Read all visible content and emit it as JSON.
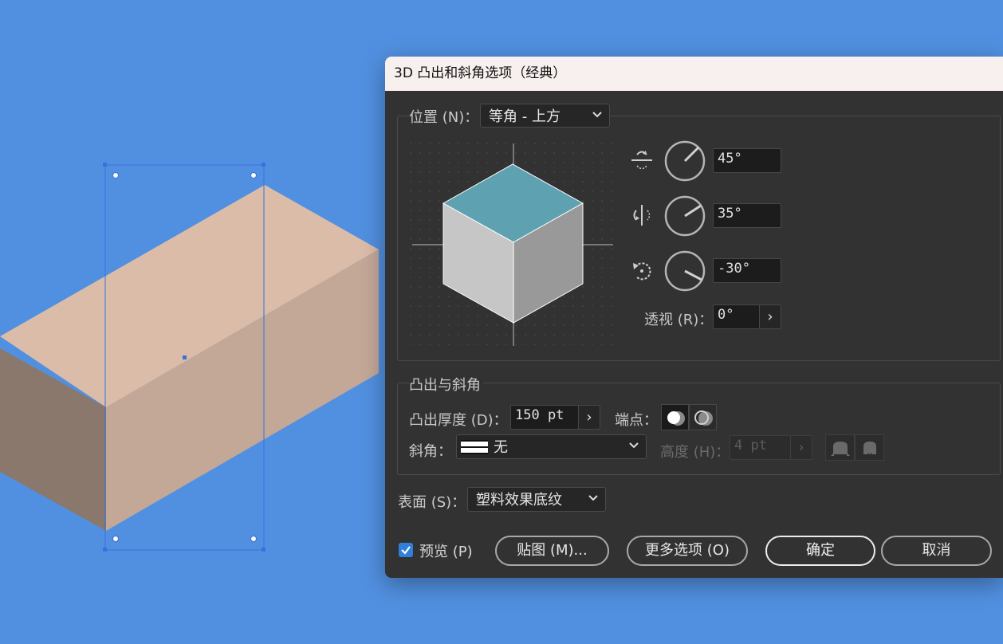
{
  "dialog": {
    "title": "3D 凸出和斜角选项（经典）",
    "position_label": "位置 (N)：",
    "position_value": "等角 - 上方",
    "rotation": {
      "x_angle": "45°",
      "y_angle": "35°",
      "z_angle": "-30°"
    },
    "perspective_label": "透视 (R)：",
    "perspective_value": "0°",
    "extrude_group_label": "凸出与斜角",
    "extrude_depth_label": "凸出厚度 (D)：",
    "extrude_depth_value": "150 pt",
    "cap_label": "端点：",
    "bevel_label": "斜角：",
    "bevel_value": "无",
    "height_label": "高度 (H)：",
    "height_value": "4 pt",
    "surface_label": "表面 (S)：",
    "surface_value": "塑料效果底纹",
    "preview_label": "预览 (P)",
    "preview_checked": true,
    "map_button": "贴图 (M)...",
    "more_options_button": "更多选项 (O)",
    "ok_button": "确定",
    "cancel_button": "取消",
    "stepper_glyph": "›",
    "dropdown_glyph": "⌄"
  },
  "colors": {
    "canvas_bg": "#5190e0",
    "box_top": "#dbbca8",
    "box_front": "#c3a898",
    "box_left": "#8a786c",
    "cube_top": "#5ea1b1",
    "cube_left": "#c6c6c6",
    "cube_right": "#999999",
    "selection": "#3a6fe0",
    "dialog_bg": "#323232",
    "titlebar_bg": "#f8f0ef",
    "checkbox": "#2f7fdb"
  }
}
